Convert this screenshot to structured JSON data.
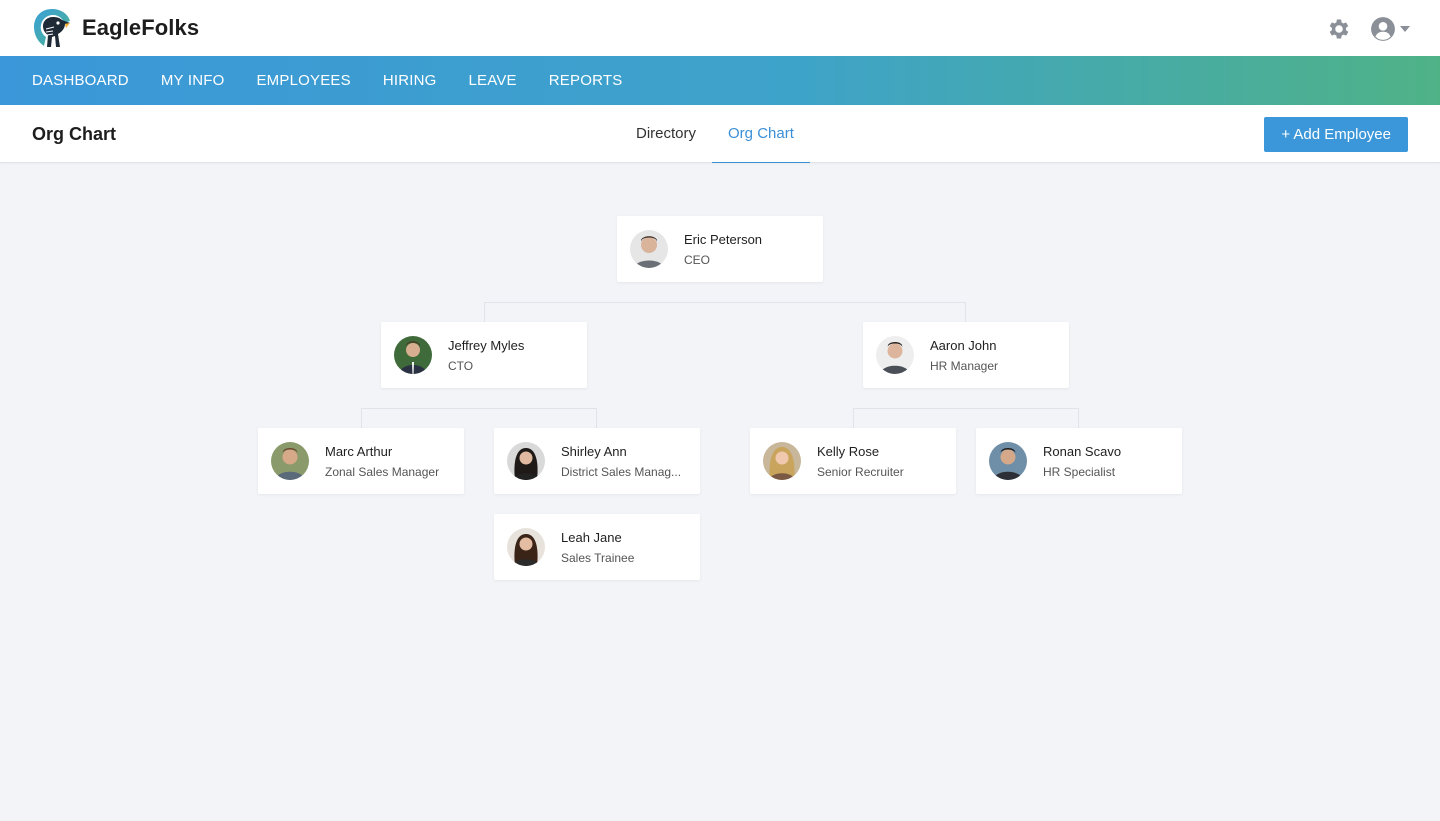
{
  "app": {
    "name": "EagleFolks"
  },
  "topbar": {
    "settings_icon": "gear-icon",
    "user_icon": "user-circle-icon"
  },
  "nav": {
    "items": [
      {
        "label": "DASHBOARD"
      },
      {
        "label": "MY INFO"
      },
      {
        "label": "EMPLOYEES"
      },
      {
        "label": "HIRING"
      },
      {
        "label": "LEAVE"
      },
      {
        "label": "REPORTS"
      }
    ],
    "gradient": [
      "#3b97d9",
      "#4fb287"
    ]
  },
  "subheader": {
    "title": "Org Chart",
    "tabs": [
      {
        "label": "Directory",
        "active": false
      },
      {
        "label": "Org Chart",
        "active": true
      }
    ],
    "add_button": "+ Add Employee"
  },
  "org": {
    "ceo": {
      "name": "Eric Peterson",
      "role": "CEO"
    },
    "cto": {
      "name": "Jeffrey Myles",
      "role": "CTO"
    },
    "hr_manager": {
      "name": "Aaron John",
      "role": "HR Manager"
    },
    "marc": {
      "name": "Marc Arthur",
      "role": "Zonal Sales Manager"
    },
    "shirley": {
      "name": "Shirley Ann",
      "role": "District Sales Manag..."
    },
    "leah": {
      "name": "Leah Jane",
      "role": "Sales Trainee"
    },
    "kelly": {
      "name": "Kelly Rose",
      "role": "Senior Recruiter"
    },
    "ronan": {
      "name": "Ronan Scavo",
      "role": "HR Specialist"
    }
  },
  "colors": {
    "accent": "#3b8fd6",
    "button": "#3b97d9",
    "background": "#f2f4f8"
  }
}
